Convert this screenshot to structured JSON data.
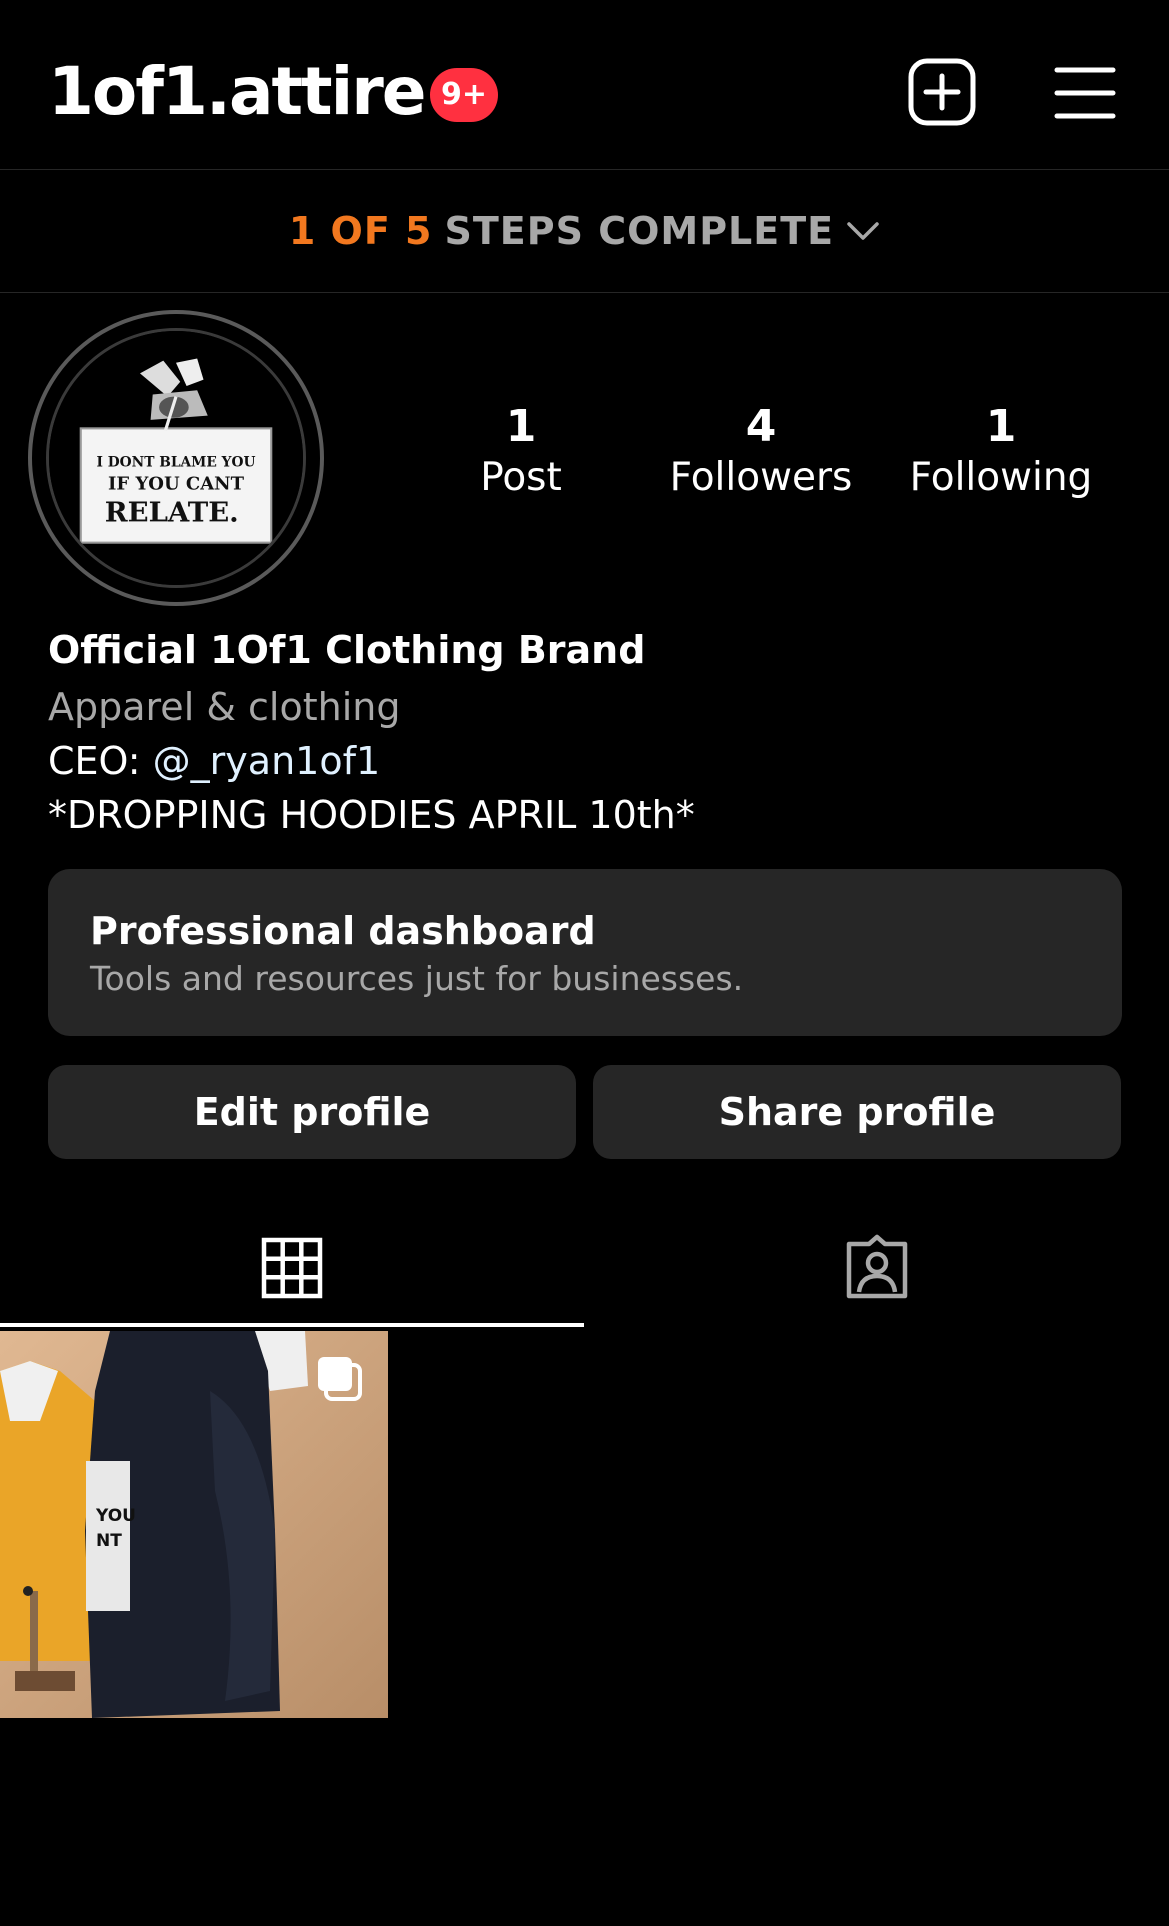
{
  "header": {
    "username": "1of1.attire",
    "notification_badge": "9+",
    "create_icon": "plus-square-icon",
    "menu_icon": "hamburger-menu-icon"
  },
  "steps": {
    "progress": "1 OF 5",
    "label": "STEPS COMPLETE",
    "icon": "chevron-down-icon"
  },
  "profile": {
    "avatar_text": [
      "I DONT BLAME YOU",
      "IF YOU CANT",
      "RELATE."
    ],
    "stats": [
      {
        "value": "1",
        "label": "Post"
      },
      {
        "value": "4",
        "label": "Followers"
      },
      {
        "value": "1",
        "label": "Following"
      }
    ],
    "name": "Official 1Of1 Clothing Brand",
    "category": "Apparel & clothing",
    "bio_ceo_prefix": "CEO: ",
    "bio_ceo_mention": "@_ryan1of1",
    "bio_announcement": "*DROPPING HOODIES APRIL 10th*"
  },
  "dashboard": {
    "title": "Professional dashboard",
    "subtitle": "Tools and resources just for businesses."
  },
  "actions": {
    "edit_label": "Edit profile",
    "share_label": "Share profile"
  },
  "tabs": [
    {
      "icon": "grid-icon",
      "active": true
    },
    {
      "icon": "tagged-person-icon",
      "active": false
    }
  ],
  "posts": [
    {
      "type": "carousel",
      "icon": "multiple-posts-icon",
      "thumb_text": [
        "YOU",
        "NT"
      ]
    }
  ],
  "colors": {
    "background": "#000000",
    "accent_orange": "#f2781f",
    "badge_red": "#ff3040",
    "card_gray": "#262626",
    "muted_text": "#a8a8a8"
  }
}
